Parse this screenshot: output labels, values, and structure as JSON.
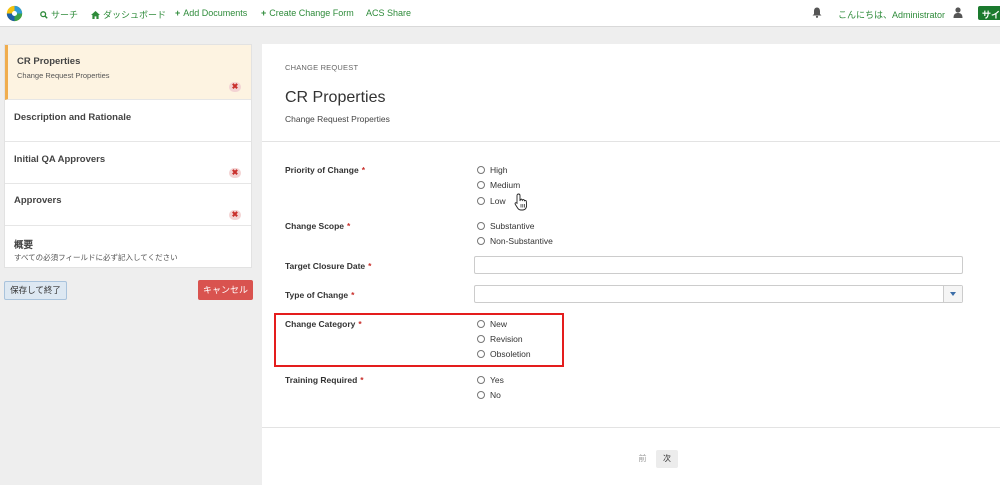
{
  "nav": {
    "search_label": "サーチ",
    "dashboard_label": "ダッシュボード",
    "add_documents_label": "Add Documents",
    "create_change_form_label": "Create Change Form",
    "acs_share_label": "ACS Share",
    "greeting": "こんにちは、Administrator",
    "signout_label": "サイン"
  },
  "sidebar": {
    "steps": [
      {
        "title": "CR Properties",
        "subtitle": "Change Request Properties",
        "has_error": true,
        "active": true
      },
      {
        "title": "Description and Rationale",
        "subtitle": "",
        "has_error": false,
        "active": false
      },
      {
        "title": "Initial QA Approvers",
        "subtitle": "",
        "has_error": true,
        "active": false
      },
      {
        "title": "Approvers",
        "subtitle": "",
        "has_error": true,
        "active": false
      },
      {
        "title": "概要",
        "subtitle": "すべての必須フィールドに必ず記入してください",
        "has_error": false,
        "active": false
      }
    ],
    "error_glyph": "✖",
    "save_label": "保存して終了",
    "cancel_label": "キャンセル"
  },
  "main": {
    "breadcrumb": "CHANGE REQUEST",
    "title": "CR Properties",
    "subtitle": "Change Request Properties",
    "required_marker": "*",
    "fields": {
      "priority": {
        "label": "Priority of Change",
        "options": [
          "High",
          "Medium",
          "Low"
        ]
      },
      "scope": {
        "label": "Change Scope",
        "options": [
          "Substantive",
          "Non-Substantive"
        ]
      },
      "closure_date": {
        "label": "Target Closure Date",
        "value": ""
      },
      "type": {
        "label": "Type of Change",
        "value": ""
      },
      "category": {
        "label": "Change Category",
        "options": [
          "New",
          "Revision",
          "Obsoletion"
        ]
      },
      "training": {
        "label": "Training Required",
        "options": [
          "Yes",
          "No"
        ]
      }
    },
    "pager": {
      "prev_label": "前",
      "next_label": "次"
    }
  },
  "colors": {
    "nav_green": "#2e8b3a",
    "active_step_bg": "#fdf3e1",
    "active_step_border": "#f0ad4e",
    "cancel_red": "#d9534f",
    "highlight_red": "#e41d1d"
  }
}
